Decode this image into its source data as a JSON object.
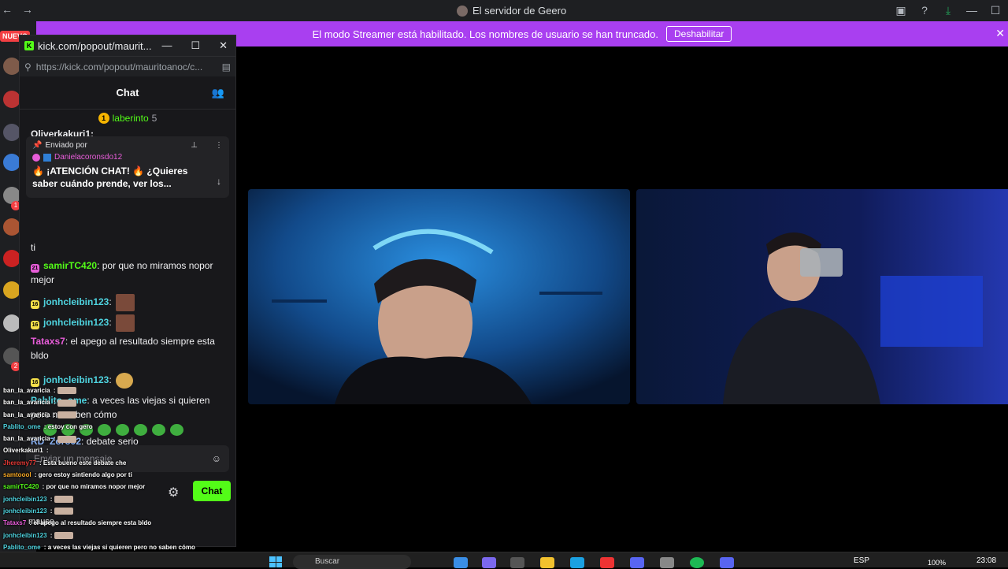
{
  "discord": {
    "window_title": "El servidor de Geero",
    "nav_back": "←",
    "nav_forward": "→",
    "new_badge": "NUEVO"
  },
  "streamer_banner": {
    "text": "El modo Streamer está habilitado. Los nombres de usuario se han truncado.",
    "button": "Deshabilitar"
  },
  "server_rail_badges": [
    "1",
    "2"
  ],
  "popout": {
    "title": "kick.com/popout/maurit...",
    "url": "https://kick.com/popout/mauritoanoc/c...",
    "chat_header": "Chat",
    "leaderboard": {
      "name": "laberinto",
      "count": "5",
      "rank": "1"
    },
    "pinned": {
      "label": "Enviado por",
      "user": "Danielacoronsdo12",
      "text": "🔥 ¡ATENCIÓN CHAT! 🔥 ¿Quieres saber cuándo prende, ver los..."
    },
    "partial_user": "Oliverkakuri1:",
    "messages": [
      {
        "user": "",
        "text": "ti",
        "color": "#efeff1",
        "badge": ""
      },
      {
        "user": "samirTC420",
        "text": "por que no miramos nopor mejor",
        "color": "#53fc18",
        "badge": "21"
      },
      {
        "user": "jonhcleibin123",
        "text": "",
        "color": "#4fd4e0",
        "badge": "16",
        "emote": "face"
      },
      {
        "user": "jonhcleibin123",
        "text": "",
        "color": "#4fd4e0",
        "badge": "16",
        "emote": "face"
      },
      {
        "user": "Tataxs7",
        "text": "el apego al resultado siempre esta bldo",
        "color": "#e85dd9",
        "badge": ""
      },
      {
        "user": "jonhcleibin123",
        "text": "",
        "color": "#4fd4e0",
        "badge": "16",
        "emote": "pray"
      },
      {
        "user": "Pablito_ome",
        "text": "a veces las viejas si quieren pero no saben cómo",
        "color": "#4fd4e0",
        "badge": ""
      },
      {
        "user": "RD_Zoro92",
        "text": "debate serio",
        "color": "#8ab4f8",
        "badge": ""
      }
    ],
    "composer_placeholder": "Enviar un mensaje",
    "send_button": "Chat"
  },
  "overlay_chat": [
    {
      "user": "ban_la_avaricia",
      "text": "",
      "color": "#ffffff",
      "emote": true
    },
    {
      "user": "ban_la_avaricia",
      "text": "",
      "color": "#ffffff",
      "emote": true
    },
    {
      "user": "ban_la_avaricia",
      "text": "",
      "color": "#ffffff",
      "emote": true
    },
    {
      "user": "Pablito_ome",
      "text": "estoy con gero",
      "color": "#4fd4e0",
      "emote": false
    },
    {
      "user": "ban_la_avaricia",
      "text": "",
      "color": "#ffffff",
      "emote": true
    },
    {
      "user": "Oliverkakuri1",
      "text": "",
      "color": "#ffffff",
      "emote": false
    },
    {
      "user": "Jheremy77",
      "text": "Esta bueno este debate che",
      "color": "#e53935",
      "emote": false
    },
    {
      "user": "samtoool",
      "text": "gero estoy sintiendo algo por ti",
      "color": "#f5a623",
      "emote": false
    },
    {
      "user": "samirTC420",
      "text": "por que no miramos nopor mejor",
      "color": "#53fc18",
      "emote": false
    },
    {
      "user": "jonhcleibin123",
      "text": "",
      "color": "#4fd4e0",
      "emote": true
    },
    {
      "user": "jonhcleibin123",
      "text": "",
      "color": "#4fd4e0",
      "emote": true
    },
    {
      "user": "Tataxs7",
      "text": "el apego al resultado siempre esta bldo",
      "color": "#e85dd9",
      "emote": false
    },
    {
      "user": "jonhcleibin123",
      "text": "",
      "color": "#4fd4e0",
      "emote": true
    },
    {
      "user": "Pablito_ome",
      "text": "a veces las viejas si quieren pero no saben cómo",
      "color": "#4fd4e0",
      "emote": false
    },
    {
      "user": "RD_Zoro92",
      "text": "debate serio",
      "color": "#8ab4f8",
      "emote": false
    }
  ],
  "overlay_voice_label": "mause",
  "taskbar": {
    "search_placeholder": "Buscar",
    "language": "ESP",
    "battery": "100%",
    "time": "23:08"
  },
  "colors": {
    "kick_green": "#53fc18",
    "discord_purple": "#a93ff0"
  }
}
